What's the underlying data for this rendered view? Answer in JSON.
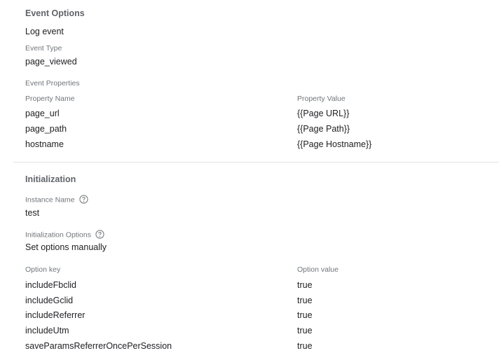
{
  "event_options": {
    "title": "Event Options",
    "tag_type": "Log event",
    "event_type_label": "Event Type",
    "event_type_value": "page_viewed",
    "event_properties_label": "Event Properties",
    "property_name_header": "Property Name",
    "property_value_header": "Property Value",
    "properties": [
      {
        "name": "page_url",
        "value": "{{Page URL}}"
      },
      {
        "name": "page_path",
        "value": "{{Page Path}}"
      },
      {
        "name": "hostname",
        "value": "{{Page Hostname}}"
      }
    ]
  },
  "initialization": {
    "title": "Initialization",
    "instance_name_label": "Instance Name",
    "instance_name_value": "test",
    "init_options_label": "Initialization Options",
    "init_options_value": "Set options manually",
    "option_key_header": "Option key",
    "option_value_header": "Option value",
    "options": [
      {
        "key": "includeFbclid",
        "value": "true"
      },
      {
        "key": "includeGclid",
        "value": "true"
      },
      {
        "key": "includeReferrer",
        "value": "true"
      },
      {
        "key": "includeUtm",
        "value": "true"
      },
      {
        "key": "saveParamsReferrerOncePerSession",
        "value": "true"
      }
    ]
  },
  "icons": {
    "help": "help-circle-icon"
  }
}
